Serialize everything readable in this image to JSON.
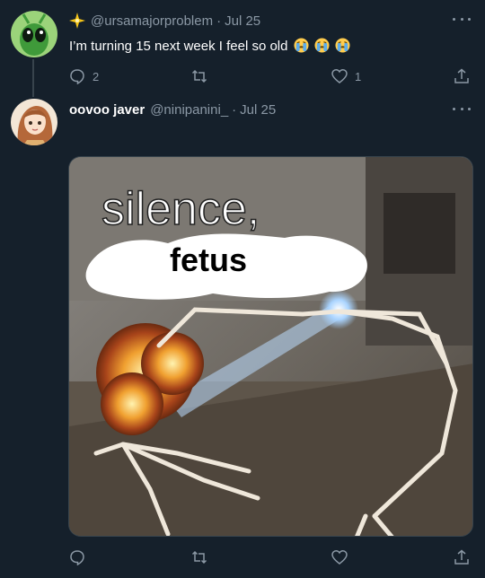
{
  "tweet1": {
    "handle": "@ursamajorproblem",
    "separator": "·",
    "date": "Jul 25",
    "text": "I’m turning 15 next week I feel so old",
    "emoji": "crying-face",
    "reply_count": "2",
    "retweet_count": "",
    "like_count": "1"
  },
  "tweet2": {
    "display_name": "oovoo javer",
    "handle": "@ninipanini_",
    "separator": "·",
    "date": "Jul 25",
    "meme_top_text": "silence,",
    "meme_caption": "fetus"
  },
  "colors": {
    "background": "#15202b",
    "muted": "#8b98a5",
    "border": "#38444d"
  }
}
